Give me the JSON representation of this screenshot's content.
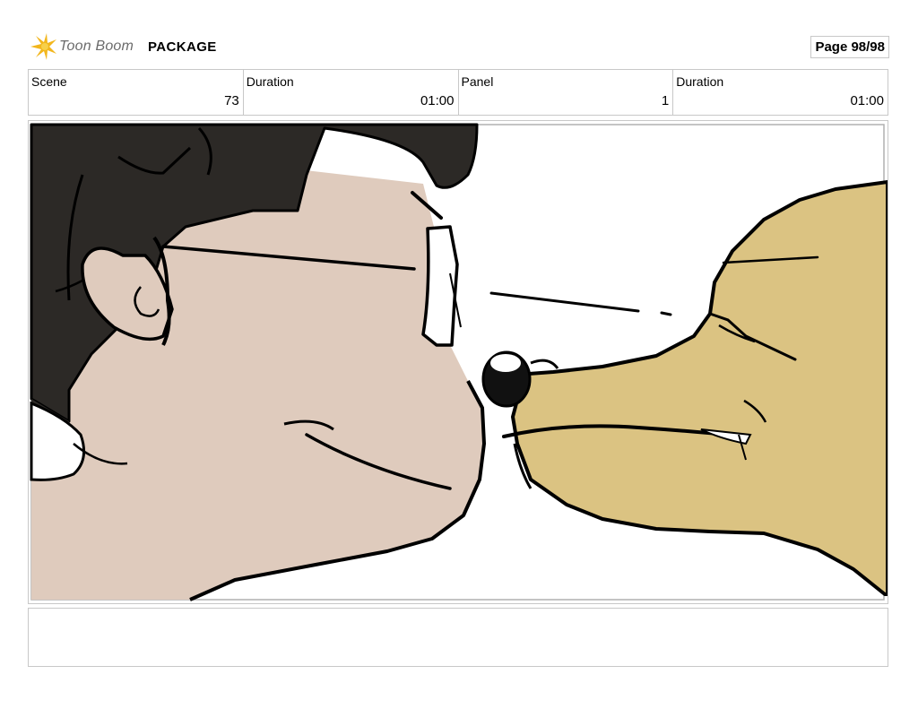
{
  "header": {
    "brand": "Toon Boom",
    "project": "PACKAGE",
    "page": "Page 98/98"
  },
  "info": {
    "scene_label": "Scene",
    "scene_value": "73",
    "scene_duration_label": "Duration",
    "scene_duration_value": "01:00",
    "panel_label": "Panel",
    "panel_value": "1",
    "panel_duration_label": "Duration",
    "panel_duration_value": "01:00"
  },
  "colors": {
    "skin": "#dfcbbd",
    "hair": "#2c2926",
    "dog": "#dbc382",
    "logo_yellow": "#f2b61c"
  },
  "notes": {
    "text": ""
  }
}
